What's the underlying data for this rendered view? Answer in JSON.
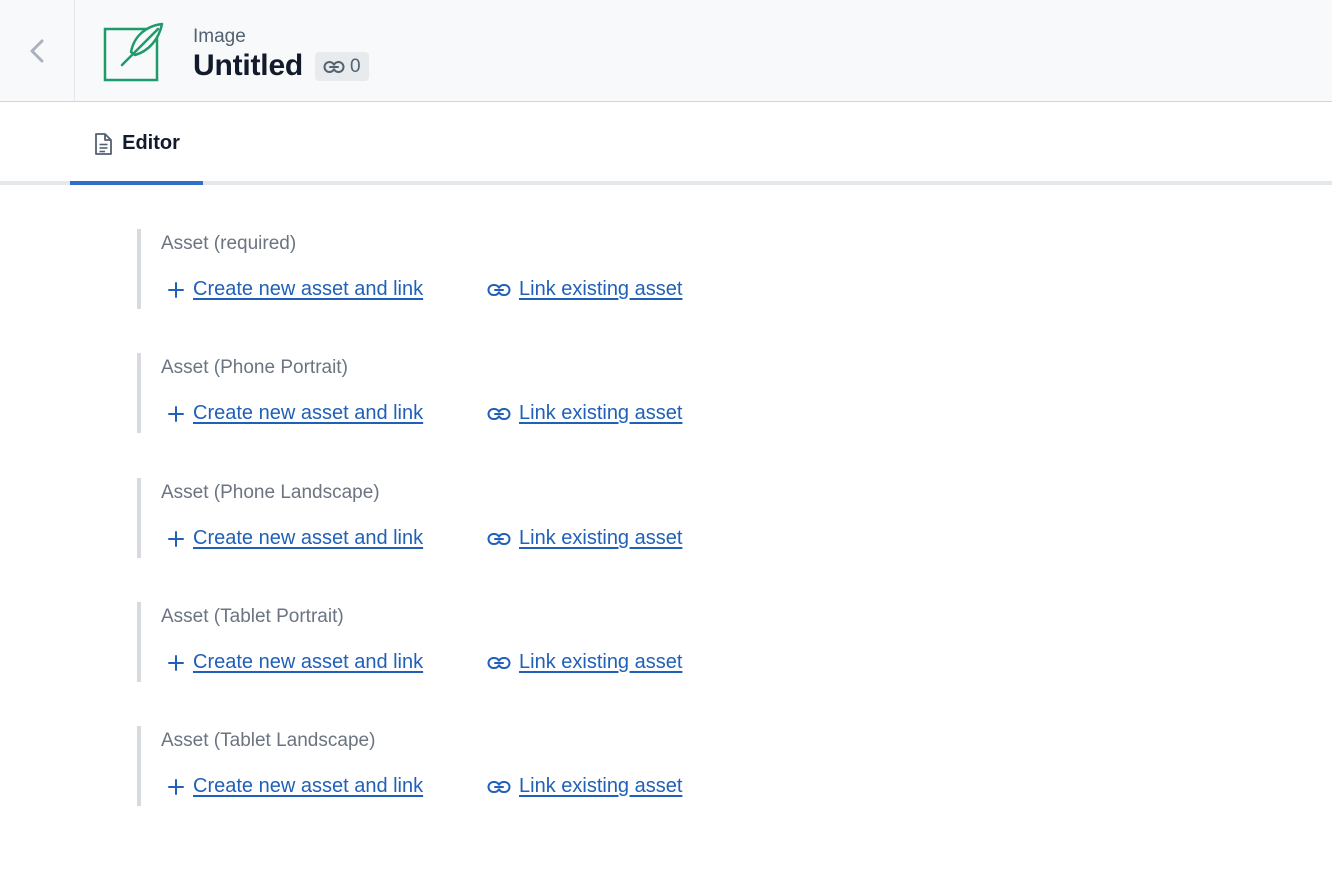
{
  "header": {
    "content_type": "Image",
    "entry_title": "Untitled",
    "reference_count": "0"
  },
  "tabs": [
    {
      "label": "Editor",
      "active": true
    }
  ],
  "fields": [
    {
      "label": "Asset (required)",
      "create_label": "Create new asset and link",
      "link_label": "Link existing asset"
    },
    {
      "label": "Asset (Phone Portrait)",
      "create_label": "Create new asset and link",
      "link_label": "Link existing asset"
    },
    {
      "label": "Asset (Phone Landscape)",
      "create_label": "Create new asset and link",
      "link_label": "Link existing asset"
    },
    {
      "label": "Asset (Tablet Portrait)",
      "create_label": "Create new asset and link",
      "link_label": "Link existing asset"
    },
    {
      "label": "Asset (Tablet Landscape)",
      "create_label": "Create new asset and link",
      "link_label": "Link existing asset"
    }
  ],
  "icons": {
    "back": "chevron-left-icon",
    "entry": "feather-icon",
    "references": "link-icon",
    "tab": "document-icon",
    "create": "plus-icon",
    "link": "link-icon"
  },
  "colors": {
    "accent": "#2f6fc6",
    "link": "#2060b8",
    "entry_icon": "#1e9a6b"
  }
}
